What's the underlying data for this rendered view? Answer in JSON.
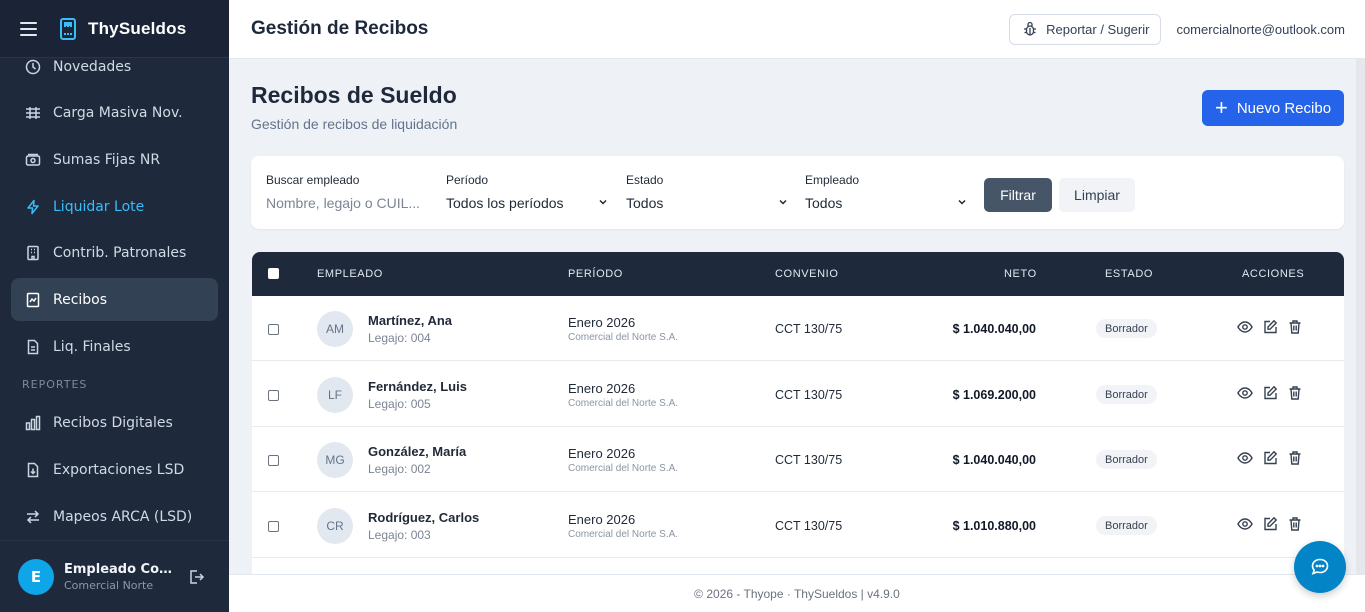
{
  "app": {
    "name": "ThySueldos"
  },
  "sidebar": {
    "items": [
      {
        "label": "Novedades",
        "icon": "clock-icon"
      },
      {
        "label": "Carga Masiva Nov.",
        "icon": "table-icon"
      },
      {
        "label": "Sumas Fijas NR",
        "icon": "cash-icon"
      },
      {
        "label": "Liquidar Lote",
        "icon": "lightning-icon"
      },
      {
        "label": "Contrib. Patronales",
        "icon": "building-icon"
      },
      {
        "label": "Recibos",
        "icon": "receipt-icon"
      },
      {
        "label": "Liq. Finales",
        "icon": "document-icon"
      }
    ],
    "section_reportes": "REPORTES",
    "report_items": [
      {
        "label": "Recibos Digitales",
        "icon": "bar-chart-icon"
      },
      {
        "label": "Exportaciones LSD",
        "icon": "file-download-icon"
      },
      {
        "label": "Mapeos ARCA (LSD)",
        "icon": "arrows-exchange-icon"
      }
    ],
    "user": {
      "initial": "E",
      "name": "Empleado Comercial Norte",
      "org": "Comercial Norte"
    }
  },
  "topbar": {
    "title": "Gestión de Recibos",
    "report_label": "Reportar / Sugerir",
    "email": "comercialnorte@outlook.com"
  },
  "page": {
    "title": "Recibos de Sueldo",
    "subtitle": "Gestión de recibos de liquidación",
    "new_button": "Nuevo Recibo"
  },
  "filters": {
    "search_label": "Buscar empleado",
    "search_placeholder": "Nombre, legajo o CUIL...",
    "periodo_label": "Período",
    "periodo_value": "Todos los períodos",
    "estado_label": "Estado",
    "estado_value": "Todos",
    "empleado_label": "Empleado",
    "empleado_value": "Todos",
    "filter_button": "Filtrar",
    "clear_button": "Limpiar"
  },
  "table": {
    "columns": {
      "empleado": "EMPLEADO",
      "periodo": "PERÍODO",
      "convenio": "CONVENIO",
      "neto": "NETO",
      "estado": "ESTADO",
      "acciones": "ACCIONES"
    },
    "rows": [
      {
        "initials": "AM",
        "name": "Martínez, Ana",
        "legajo": "Legajo: 004",
        "periodo": "Enero 2026",
        "empresa": "Comercial del Norte S.A.",
        "convenio": "CCT 130/75",
        "neto": "$ 1.040.040,00",
        "estado": "Borrador"
      },
      {
        "initials": "LF",
        "name": "Fernández, Luis",
        "legajo": "Legajo: 005",
        "periodo": "Enero 2026",
        "empresa": "Comercial del Norte S.A.",
        "convenio": "CCT 130/75",
        "neto": "$ 1.069.200,00",
        "estado": "Borrador"
      },
      {
        "initials": "MG",
        "name": "González, María",
        "legajo": "Legajo: 002",
        "periodo": "Enero 2026",
        "empresa": "Comercial del Norte S.A.",
        "convenio": "CCT 130/75",
        "neto": "$ 1.040.040,00",
        "estado": "Borrador"
      },
      {
        "initials": "CR",
        "name": "Rodríguez, Carlos",
        "legajo": "Legajo: 003",
        "periodo": "Enero 2026",
        "empresa": "Comercial del Norte S.A.",
        "convenio": "CCT 130/75",
        "neto": "$ 1.010.880,00",
        "estado": "Borrador"
      }
    ]
  },
  "footer": {
    "text": "© 2026 - Thyope · ThySueldos | v4.9.0"
  },
  "colors": {
    "sidebar": "#1e293b",
    "accent": "#38bdf8",
    "primary": "#2563eb",
    "fab": "#0284c7"
  }
}
